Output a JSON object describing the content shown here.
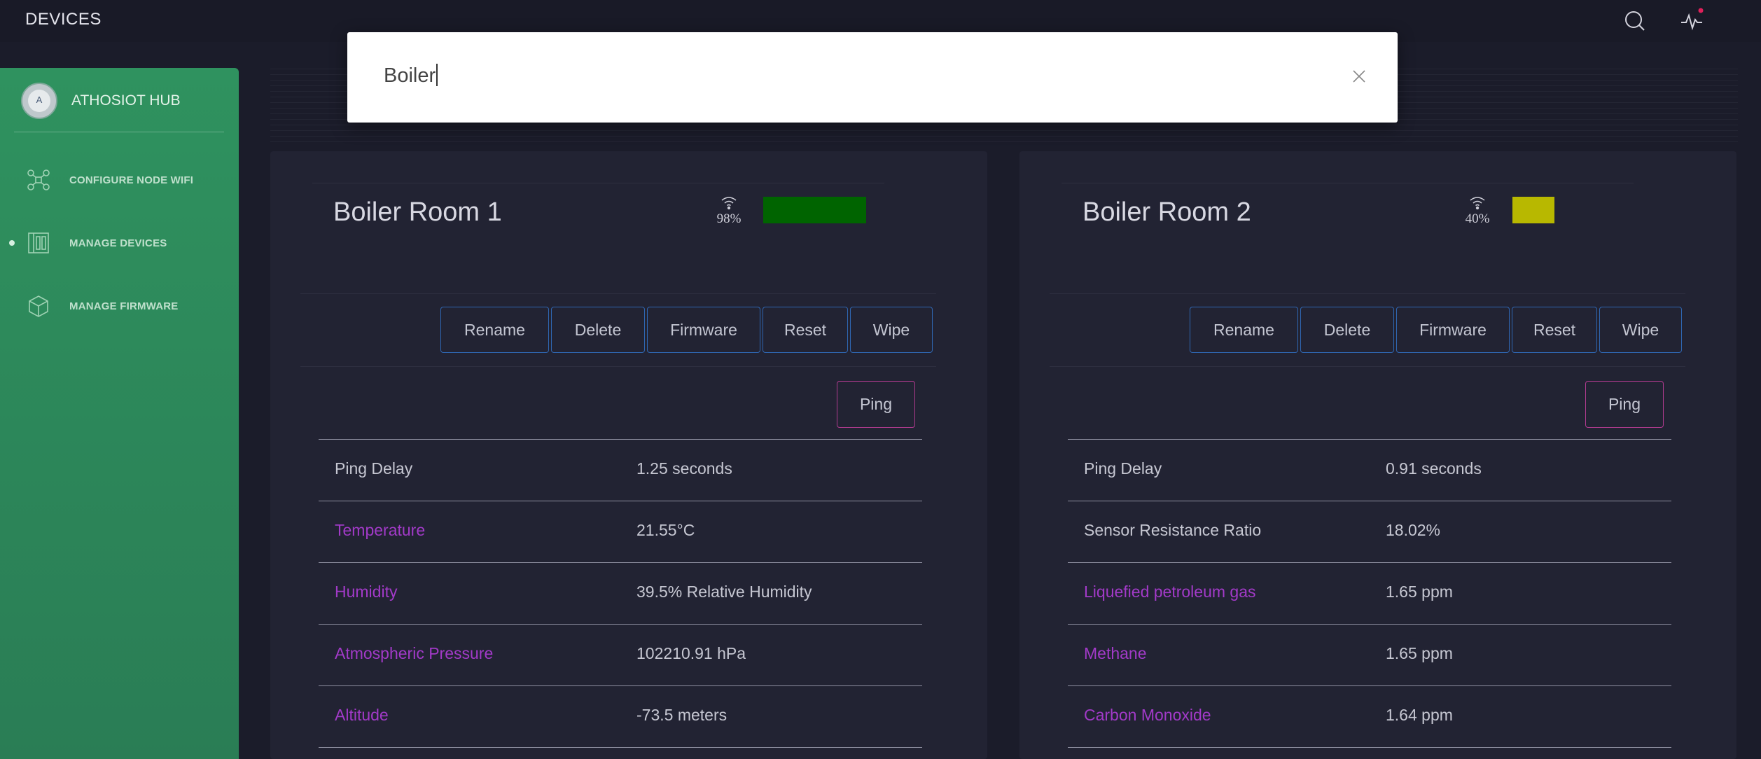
{
  "header": {
    "title": "DEVICES"
  },
  "sidebar": {
    "brand": "ATHOSIOT HUB",
    "items": [
      {
        "label": "CONFIGURE NODE WIFI",
        "icon": "drone-network-icon",
        "active": false
      },
      {
        "label": "MANAGE DEVICES",
        "icon": "devices-grid-icon",
        "active": true
      },
      {
        "label": "MANAGE FIRMWARE",
        "icon": "box-icon",
        "active": false
      }
    ]
  },
  "search": {
    "value": "Boiler",
    "close_icon": "close-icon"
  },
  "colors": {
    "sidebar_green": "#2f925f",
    "button_border": "#2f67b3",
    "ping_border": "#b03b8f",
    "accent_label": "#a23ac8",
    "signal_strong": "#006400",
    "signal_medium": "#b8b800",
    "notification_dot": "#e0205a"
  },
  "buttons": {
    "rename": "Rename",
    "delete": "Delete",
    "firmware": "Firmware",
    "reset": "Reset",
    "wipe": "Wipe",
    "ping": "Ping"
  },
  "devices": [
    {
      "name": "Boiler Room 1",
      "signal": "98%",
      "signal_level": 0.98,
      "rows": [
        {
          "label": "Ping Delay",
          "value": "1.25 seconds"
        },
        {
          "label": "Temperature",
          "value": "21.55°C"
        },
        {
          "label": "Humidity",
          "value": "39.5% Relative Humidity"
        },
        {
          "label": "Atmospheric Pressure",
          "value": "102210.91 hPa"
        },
        {
          "label": "Altitude",
          "value": "-73.5 meters"
        }
      ]
    },
    {
      "name": "Boiler Room 2",
      "signal": "40%",
      "signal_level": 0.4,
      "rows": [
        {
          "label": "Ping Delay",
          "value": "0.91 seconds"
        },
        {
          "label": "Sensor Resistance Ratio",
          "value": "18.02%"
        },
        {
          "label": "Liquefied petroleum gas",
          "value": "1.65 ppm"
        },
        {
          "label": "Methane",
          "value": "1.65 ppm"
        },
        {
          "label": "Carbon Monoxide",
          "value": "1.64 ppm"
        }
      ]
    }
  ]
}
